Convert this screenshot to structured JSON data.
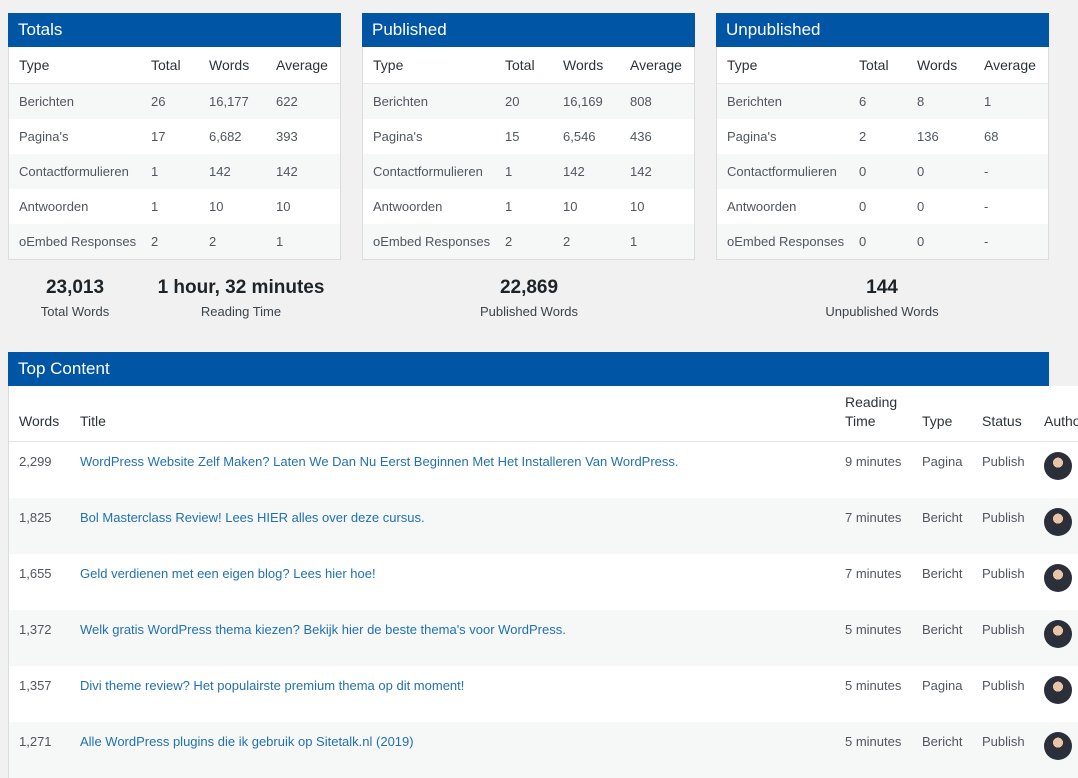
{
  "panels": [
    {
      "title": "Totals",
      "headers": [
        "Type",
        "Total",
        "Words",
        "Average"
      ],
      "rows": [
        [
          "Berichten",
          "26",
          "16,177",
          "622"
        ],
        [
          "Pagina's",
          "17",
          "6,682",
          "393"
        ],
        [
          "Contactformulieren",
          "1",
          "142",
          "142"
        ],
        [
          "Antwoorden",
          "1",
          "10",
          "10"
        ],
        [
          "oEmbed Responses",
          "2",
          "2",
          "1"
        ]
      ]
    },
    {
      "title": "Published",
      "headers": [
        "Type",
        "Total",
        "Words",
        "Average"
      ],
      "rows": [
        [
          "Berichten",
          "20",
          "16,169",
          "808"
        ],
        [
          "Pagina's",
          "15",
          "6,546",
          "436"
        ],
        [
          "Contactformulieren",
          "1",
          "142",
          "142"
        ],
        [
          "Antwoorden",
          "1",
          "10",
          "10"
        ],
        [
          "oEmbed Responses",
          "2",
          "2",
          "1"
        ]
      ]
    },
    {
      "title": "Unpublished",
      "headers": [
        "Type",
        "Total",
        "Words",
        "Average"
      ],
      "rows": [
        [
          "Berichten",
          "6",
          "8",
          "1"
        ],
        [
          "Pagina's",
          "2",
          "136",
          "68"
        ],
        [
          "Contactformulieren",
          "0",
          "0",
          "-"
        ],
        [
          "Antwoorden",
          "0",
          "0",
          "-"
        ],
        [
          "oEmbed Responses",
          "0",
          "0",
          "-"
        ]
      ]
    }
  ],
  "stats": {
    "total_words": {
      "value": "23,013",
      "label": "Total Words"
    },
    "reading_time": {
      "value": "1 hour, 32 minutes",
      "label": "Reading Time"
    },
    "published_words": {
      "value": "22,869",
      "label": "Published Words"
    },
    "unpublished_words": {
      "value": "144",
      "label": "Unpublished Words"
    }
  },
  "top_content": {
    "title": "Top Content",
    "headers": {
      "words": "Words",
      "title": "Title",
      "reading_time": "Reading Time",
      "type": "Type",
      "status": "Status",
      "author": "Author"
    },
    "rows": [
      {
        "words": "2,299",
        "title": "WordPress Website Zelf Maken? Laten We Dan Nu Eerst Beginnen Met Het Installeren Van WordPress.",
        "reading_time": "9 minutes",
        "type": "Pagina",
        "status": "Publish"
      },
      {
        "words": "1,825",
        "title": "Bol Masterclass Review! Lees HIER alles over deze cursus.",
        "reading_time": "7 minutes",
        "type": "Bericht",
        "status": "Publish"
      },
      {
        "words": "1,655",
        "title": "Geld verdienen met een eigen blog? Lees hier hoe!",
        "reading_time": "7 minutes",
        "type": "Bericht",
        "status": "Publish"
      },
      {
        "words": "1,372",
        "title": "Welk gratis WordPress thema kiezen? Bekijk hier de beste thema's voor WordPress.",
        "reading_time": "5 minutes",
        "type": "Bericht",
        "status": "Publish"
      },
      {
        "words": "1,357",
        "title": "Divi theme review? Het populairste premium thema op dit moment!",
        "reading_time": "5 minutes",
        "type": "Pagina",
        "status": "Publish"
      },
      {
        "words": "1,271",
        "title": "Alle WordPress plugins die ik gebruik op Sitetalk.nl (2019)",
        "reading_time": "5 minutes",
        "type": "Bericht",
        "status": "Publish"
      }
    ]
  },
  "colors": {
    "header_blue": "#0055a5",
    "link": "#2271b1"
  }
}
